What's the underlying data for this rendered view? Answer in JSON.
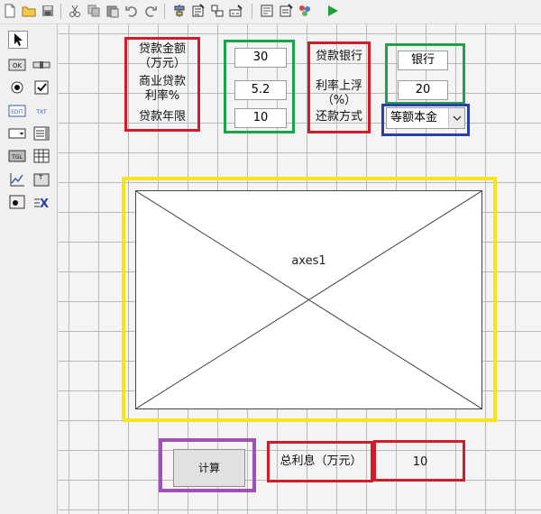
{
  "palette": {
    "selected": "pointer-tool"
  },
  "form": {
    "loan_amount": {
      "label_line1": "贷款金额",
      "label_line2": "（万元）",
      "value": "30"
    },
    "commercial_rate": {
      "label_line1": "商业贷款",
      "label_line2": "利率%",
      "value": "5.2"
    },
    "loan_years": {
      "label": "贷款年限",
      "value": "10"
    },
    "loan_bank": {
      "label": "贷款银行",
      "value": "银行"
    },
    "rate_float": {
      "label_line1": "利率上浮",
      "label_line2": "（%）",
      "value": "20"
    },
    "repayment": {
      "label": "还款方式",
      "value": "等额本金"
    },
    "axes_label": "axes1",
    "calculate_button": "计算",
    "total_interest": {
      "label": "总利息（万元）",
      "value": "10"
    }
  },
  "colors": {
    "red": "#d11d2a",
    "green": "#1ea34a",
    "blue": "#2d3ea6",
    "yellow": "#f5e418",
    "purple": "#a150b3"
  }
}
